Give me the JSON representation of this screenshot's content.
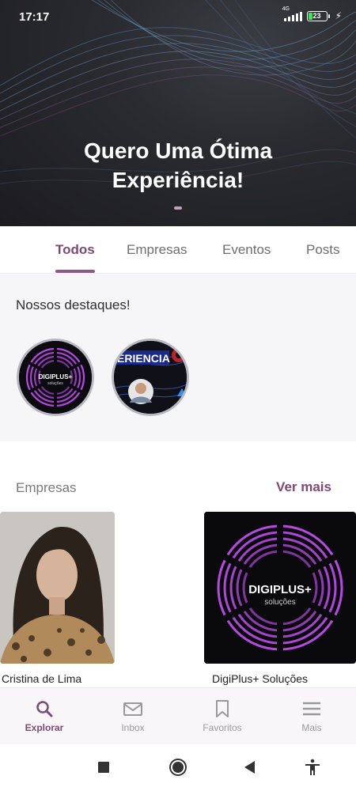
{
  "status_bar": {
    "time": "17:17",
    "network": "4G",
    "battery": "23",
    "battery_level_percent": 23
  },
  "hero": {
    "title_line1": "Quero Uma Ótima",
    "title_line2": "Experiência!"
  },
  "tabs": [
    {
      "label": "Todos",
      "active": true
    },
    {
      "label": "Empresas",
      "active": false
    },
    {
      "label": "Eventos",
      "active": false
    },
    {
      "label": "Posts",
      "active": false
    }
  ],
  "highlights": {
    "title": "Nossos destaques!",
    "story2_text": "ERIENCIA"
  },
  "companies": {
    "title": "Empresas",
    "see_more": "Ver mais",
    "items": [
      {
        "name": "Cristina de Lima"
      },
      {
        "name": "DigiPlus+ Soluções",
        "logo_text": "DIGIPLUS+",
        "logo_subtext": "soluções"
      }
    ]
  },
  "bottom_nav": [
    {
      "label": "Explorar",
      "icon": "search-icon",
      "active": true
    },
    {
      "label": "Inbox",
      "icon": "mail-icon",
      "active": false
    },
    {
      "label": "Favoritos",
      "icon": "bookmark-icon",
      "active": false
    },
    {
      "label": "Mais",
      "icon": "menu-icon",
      "active": false
    }
  ],
  "colors": {
    "accent": "#7d4a74",
    "hero_bg": "#2a2b30",
    "neon_purple": "#c24cf0"
  }
}
